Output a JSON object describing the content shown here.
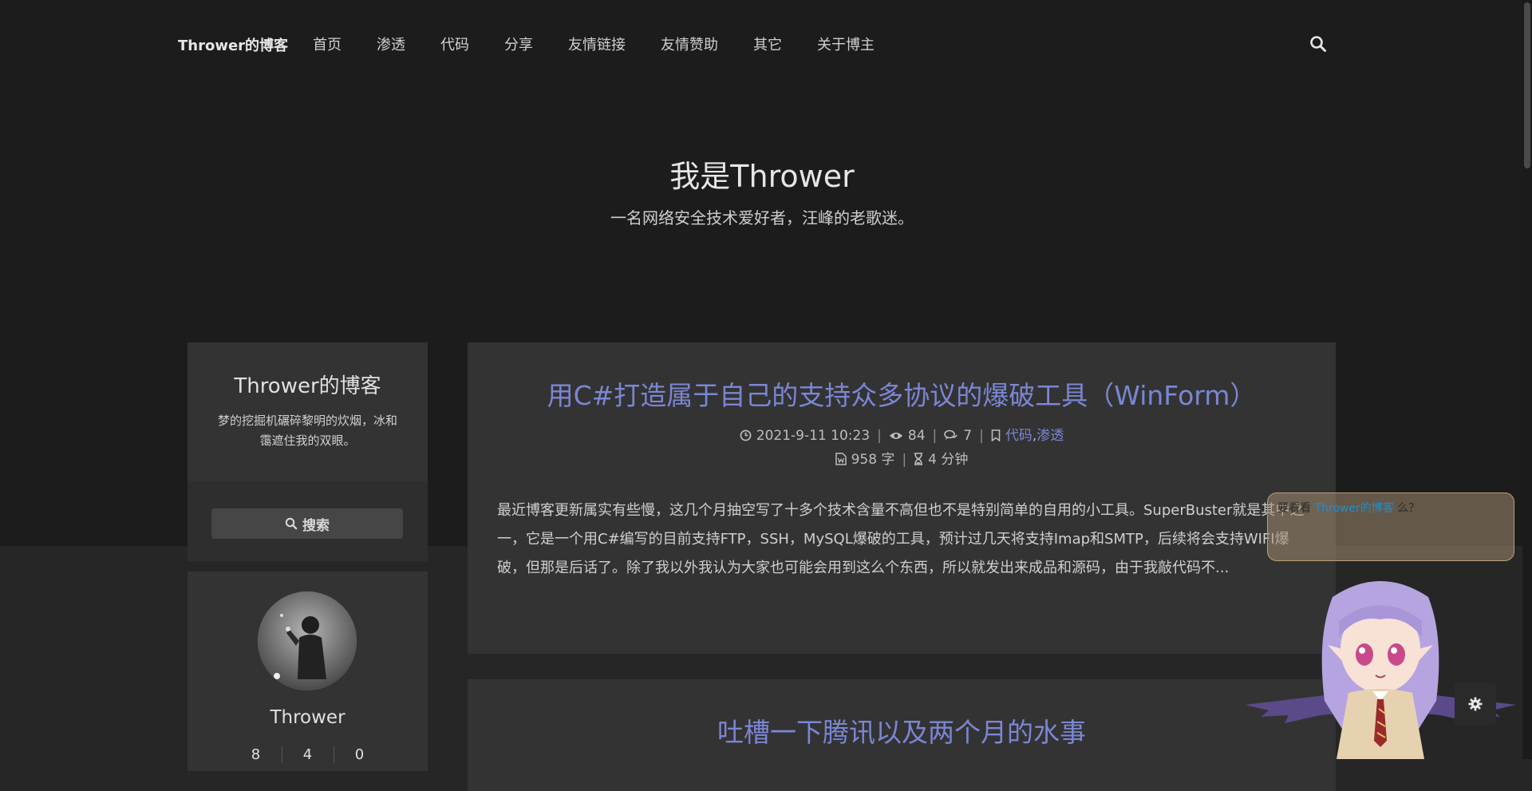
{
  "header": {
    "brand": "Thrower的博客",
    "nav": [
      "首页",
      "渗透",
      "代码",
      "分享",
      "友情链接",
      "友情赞助",
      "其它",
      "关于博主"
    ]
  },
  "hero": {
    "title": "我是Thrower",
    "subtitle": "一名网络安全技术爱好者，汪峰的老歌迷。"
  },
  "sidebar": {
    "site_name": "Thrower的博客",
    "site_desc": "梦的挖掘机碾碎黎明的炊烟，冰和霭遮住我的双眼。",
    "search_label": "搜索",
    "author_name": "Thrower",
    "stats": [
      "8",
      "4",
      "0"
    ]
  },
  "posts": [
    {
      "title": "用C#打造属于自己的支持众多协议的爆破工具（WinForm）",
      "date": "2021-9-11 10:23",
      "views": "84",
      "comments": "7",
      "categories": [
        "代码",
        "渗透"
      ],
      "cat_sep": ",",
      "words": "958 字",
      "read_time": "4 分钟",
      "excerpt": "最近博客更新属实有些慢，这几个月抽空写了十多个技术含量不高但也不是特别简单的自用的小工具。SuperBuster就是其中之一，它是一个用C#编写的目前支持FTP，SSH，MySQL爆破的工具，预计过几天将支持Imap和SMTP，后续将会支持WIFI爆破，但那是后话了。除了我以外我认为大家也可能会用到这么个东西，所以就发出来成品和源码，由于我敲代码不..."
    },
    {
      "title": "吐槽一下腾讯以及两个月的水事"
    }
  ],
  "widget": {
    "bubble_prefix": "要看看 ",
    "bubble_highlight": "Thrower的博客",
    "bubble_suffix": " 么？"
  },
  "icons": {
    "search": "search-icon",
    "clock": "clock-icon",
    "eye": "eye-icon",
    "comments": "comments-icon",
    "bookmark": "bookmark-icon",
    "word": "file-word-icon",
    "hourglass": "hourglass-icon",
    "gear": "gear-icon"
  },
  "colors": {
    "accent": "#7b86d4",
    "background": "#1c1c1c",
    "card": "#333333"
  }
}
